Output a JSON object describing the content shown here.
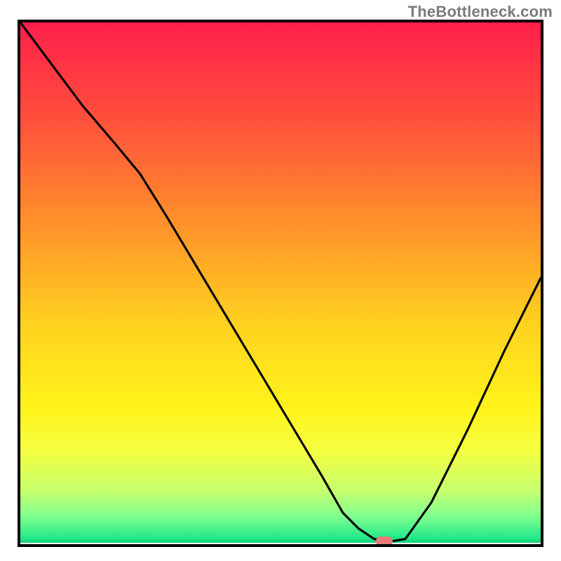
{
  "watermark": "TheBottleneck.com",
  "chart_data": {
    "type": "line",
    "title": "",
    "xlabel": "",
    "ylabel": "",
    "xlim": [
      0,
      100
    ],
    "ylim": [
      0,
      100
    ],
    "grid": false,
    "legend": false,
    "background": {
      "type": "vertical_gradient",
      "stops": [
        {
          "offset_pct": 0,
          "color": "#ff1f4b"
        },
        {
          "offset_pct": 18,
          "color": "#ff4e3c"
        },
        {
          "offset_pct": 38,
          "color": "#ff8f2b"
        },
        {
          "offset_pct": 58,
          "color": "#ffd21f"
        },
        {
          "offset_pct": 74,
          "color": "#fffm31a"
        },
        {
          "offset_pct": 82,
          "color": "#f6ff3f"
        },
        {
          "offset_pct": 90,
          "color": "#c7ff6e"
        },
        {
          "offset_pct": 95,
          "color": "#7fff8f"
        },
        {
          "offset_pct": 99,
          "color": "#24e98a"
        },
        {
          "offset_pct": 100,
          "color": "#0fd475"
        }
      ]
    },
    "series": [
      {
        "name": "bottleneck_curve",
        "color": "#000000",
        "x": [
          0,
          6,
          12,
          18,
          23,
          28,
          34,
          40,
          46,
          52,
          58,
          62,
          65,
          68,
          71,
          74,
          79,
          86,
          93,
          100
        ],
        "y": [
          100,
          92,
          84,
          77,
          71,
          63,
          53,
          43,
          33,
          23,
          13,
          6,
          3,
          1,
          0.5,
          1,
          8,
          22,
          37,
          51
        ]
      }
    ],
    "marker": {
      "x": 70,
      "y": 0.6,
      "color": "#e77b79",
      "shape": "pill"
    }
  }
}
